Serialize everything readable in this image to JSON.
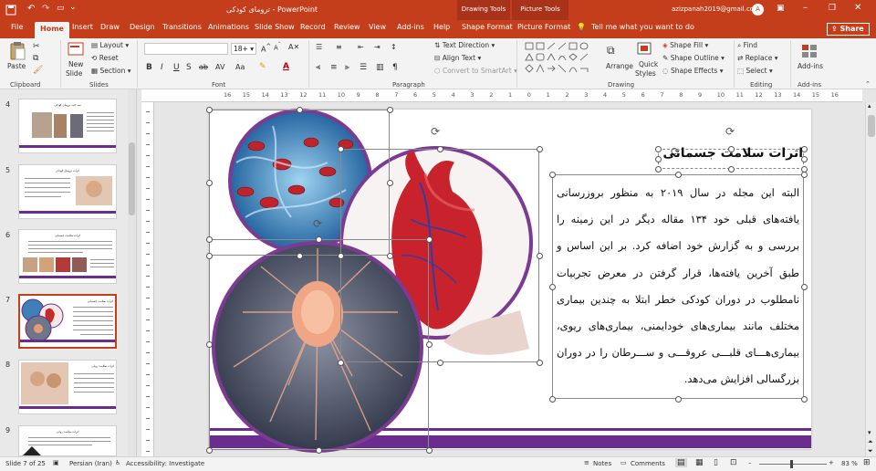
{
  "window": {
    "title": "ترومای کودکی  -  PowerPoint",
    "context_groups": [
      "Drawing Tools",
      "Picture Tools"
    ],
    "user_email": "azizpanah2019@gmail.com",
    "avatar_letter": "A"
  },
  "tabs": [
    "File",
    "Home",
    "Insert",
    "Draw",
    "Design",
    "Transitions",
    "Animations",
    "Slide Show",
    "Record",
    "Review",
    "View",
    "Add-ins",
    "Help",
    "Shape Format",
    "Picture Format"
  ],
  "active_tab": "Home",
  "tell_me": "Tell me what you want to do",
  "share_label": "Share",
  "ribbon": {
    "clipboard": {
      "label": "Clipboard",
      "paste": "Paste"
    },
    "slides": {
      "label": "Slides",
      "new_slide_1": "New",
      "new_slide_2": "Slide",
      "layout": "Layout",
      "reset": "Reset",
      "section": "Section"
    },
    "font": {
      "label": "Font",
      "font_size": "18+"
    },
    "paragraph": {
      "label": "Paragraph",
      "text_direction": "Text Direction",
      "align_text": "Align Text",
      "convert_smartart": "Convert to SmartArt"
    },
    "drawing": {
      "label": "Drawing",
      "arrange": "Arrange",
      "quick_styles_1": "Quick",
      "quick_styles_2": "Styles",
      "shape_fill": "Shape Fill",
      "shape_outline": "Shape Outline",
      "shape_effects": "Shape Effects"
    },
    "editing": {
      "label": "Editing",
      "find": "Find",
      "replace": "Replace",
      "select": "Select"
    },
    "addins": {
      "label": "Add-ins",
      "addins_btn": "Add-ins"
    }
  },
  "thumbnails": [
    {
      "number": "4",
      "title": "سه جنبه ترومای کودکی"
    },
    {
      "number": "5",
      "title": "اثرات ترومای کودکی"
    },
    {
      "number": "6",
      "title": "اثرات سلامت جسمانی"
    },
    {
      "number": "7",
      "title": "اثرات سلامت جسمانی"
    },
    {
      "number": "8",
      "title": "اثرات سلامت روانی"
    },
    {
      "number": "9",
      "title": "اثرات سلامت روانی"
    }
  ],
  "ruler_marks": [
    "16",
    "15",
    "14",
    "13",
    "12",
    "11",
    "10",
    "9",
    "8",
    "7",
    "6",
    "5",
    "4",
    "3",
    "2",
    "1",
    "0",
    "1",
    "2",
    "3",
    "4",
    "5",
    "6",
    "7",
    "8",
    "9",
    "10",
    "11",
    "12",
    "13",
    "14",
    "15",
    "16"
  ],
  "slide": {
    "title": "اثرات سلامت جسمانی",
    "body": "البته این مجله در سال ۲۰۱۹ به منظور بروزرسانی یافته‌های قبلی خود ۱۳۴ مقاله دیگر در این زمینه را بررسی و به گزارش خود اضافه کرد. بر این اساس و طبق آخرین یافته‌ها، قرار گرفتن در معرض تجربیات نامطلوب در دوران کودکی خطر ابتلا به چندین بیماری مختلف مانند بیماری‌های خودایمنی، بیماری‌های ریوی، بیماری‌هـــای قلبـــی عروقـــی و ســـرطان را در دوران بزرگسالی افزایش می‌دهد.",
    "accent_color": "#6a2c8f"
  },
  "status": {
    "slide_of": "Slide 7 of 25",
    "language": "Persian (Iran)",
    "accessibility": "Accessibility: Investigate",
    "notes": "Notes",
    "comments": "Comments",
    "zoom": "83 %"
  },
  "colors": {
    "brand": "#c43e1c",
    "ribbon_bg": "#f3f3f3"
  }
}
